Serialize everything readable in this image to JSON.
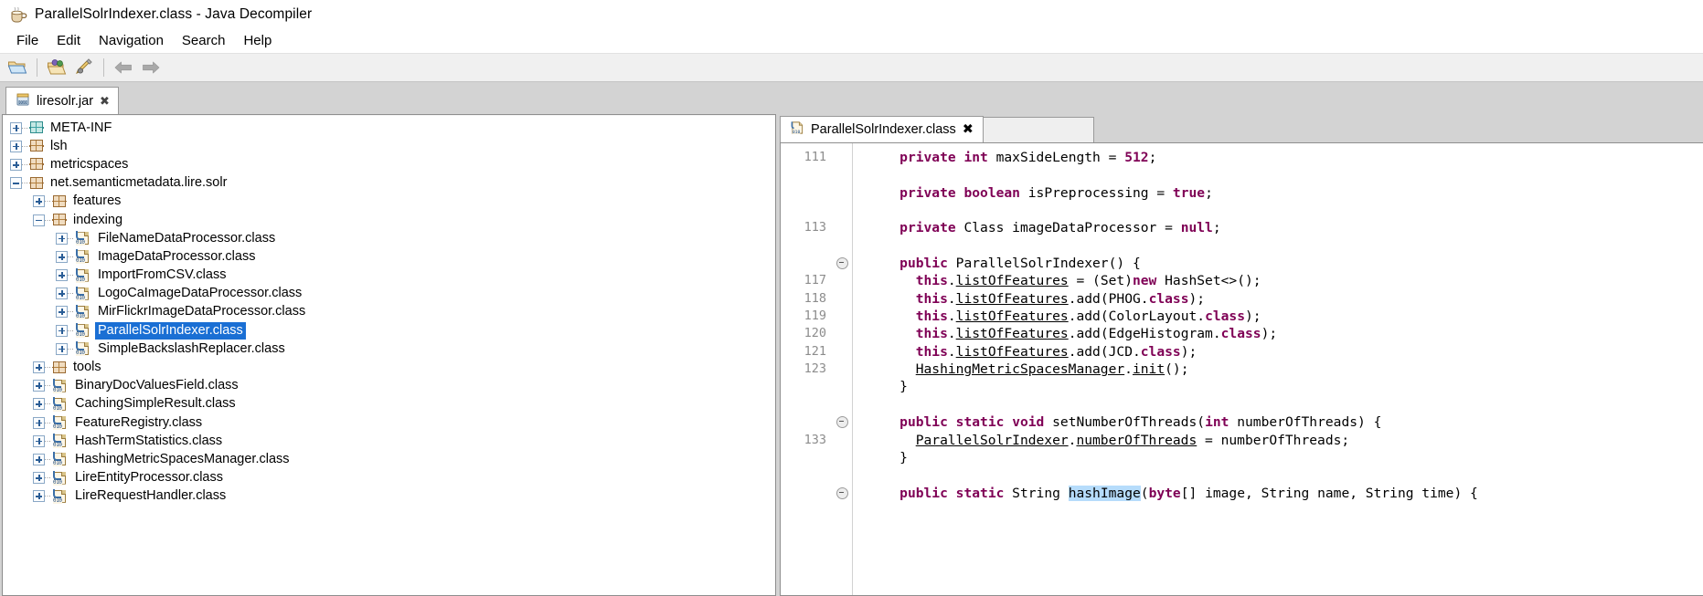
{
  "window": {
    "title": "ParallelSolrIndexer.class - Java Decompiler",
    "icon": "coffee-cup-icon"
  },
  "menubar": {
    "items": [
      "File",
      "Edit",
      "Navigation",
      "Search",
      "Help"
    ]
  },
  "toolbar": {
    "buttons": [
      {
        "name": "open-file-icon",
        "title": "Open File"
      },
      {
        "name": "open-type-icon",
        "title": "Open Type"
      },
      {
        "name": "search-pen-icon",
        "title": "Search"
      },
      {
        "name": "back-arrow-icon",
        "title": "Back"
      },
      {
        "name": "forward-arrow-icon",
        "title": "Forward"
      }
    ]
  },
  "jar_tabs": [
    {
      "label": "liresolr.jar",
      "close": "✖",
      "active": true
    }
  ],
  "tree": {
    "rows": [
      {
        "indent": 0,
        "expander": "plus",
        "icon": "package-teal",
        "label": "META-INF",
        "selected": false
      },
      {
        "indent": 0,
        "expander": "plus",
        "icon": "package",
        "label": "lsh",
        "selected": false
      },
      {
        "indent": 0,
        "expander": "plus",
        "icon": "package",
        "label": "metricspaces",
        "selected": false
      },
      {
        "indent": 0,
        "expander": "minus",
        "icon": "package",
        "label": "net.semanticmetadata.lire.solr",
        "selected": false
      },
      {
        "indent": 1,
        "expander": "plus",
        "icon": "package",
        "label": "features",
        "selected": false
      },
      {
        "indent": 1,
        "expander": "minus",
        "icon": "package",
        "label": "indexing",
        "selected": false
      },
      {
        "indent": 2,
        "expander": "plus",
        "icon": "class",
        "label": "FileNameDataProcessor.class",
        "selected": false
      },
      {
        "indent": 2,
        "expander": "plus",
        "icon": "class",
        "label": "ImageDataProcessor.class",
        "selected": false
      },
      {
        "indent": 2,
        "expander": "plus",
        "icon": "class",
        "label": "ImportFromCSV.class",
        "selected": false
      },
      {
        "indent": 2,
        "expander": "plus",
        "icon": "class",
        "label": "LogoCaImageDataProcessor.class",
        "selected": false
      },
      {
        "indent": 2,
        "expander": "plus",
        "icon": "class",
        "label": "MirFlickrImageDataProcessor.class",
        "selected": false
      },
      {
        "indent": 2,
        "expander": "plus",
        "icon": "class",
        "label": "ParallelSolrIndexer.class",
        "selected": true
      },
      {
        "indent": 2,
        "expander": "plus",
        "icon": "class",
        "label": "SimpleBackslashReplacer.class",
        "selected": false
      },
      {
        "indent": 1,
        "expander": "plus",
        "icon": "package",
        "label": "tools",
        "selected": false
      },
      {
        "indent": 1,
        "expander": "plus",
        "icon": "class",
        "label": "BinaryDocValuesField.class",
        "selected": false
      },
      {
        "indent": 1,
        "expander": "plus",
        "icon": "class",
        "label": "CachingSimpleResult.class",
        "selected": false
      },
      {
        "indent": 1,
        "expander": "plus",
        "icon": "class",
        "label": "FeatureRegistry.class",
        "selected": false
      },
      {
        "indent": 1,
        "expander": "plus",
        "icon": "class",
        "label": "HashTermStatistics.class",
        "selected": false
      },
      {
        "indent": 1,
        "expander": "plus",
        "icon": "class",
        "label": "HashingMetricSpacesManager.class",
        "selected": false
      },
      {
        "indent": 1,
        "expander": "plus",
        "icon": "class",
        "label": "LireEntityProcessor.class",
        "selected": false
      },
      {
        "indent": 1,
        "expander": "plus",
        "icon": "class",
        "label": "LireRequestHandler.class",
        "selected": false
      }
    ],
    "selection_color": "#1a6fd4"
  },
  "editor": {
    "tabs": [
      {
        "label": "ParallelSolrIndexer.class",
        "close": "✖",
        "active": true
      }
    ],
    "colors": {
      "keyword": "#7f0055",
      "highlight": "#b6dcfb",
      "gutter": "#8c8c8c"
    },
    "lines": [
      {
        "num": "111",
        "fold": false,
        "tokens": [
          {
            "t": "    ",
            "c": "plain"
          },
          {
            "t": "private",
            "c": "kw"
          },
          {
            "t": " ",
            "c": "plain"
          },
          {
            "t": "int",
            "c": "kw"
          },
          {
            "t": " maxSideLength = ",
            "c": "plain"
          },
          {
            "t": "512",
            "c": "kw"
          },
          {
            "t": ";",
            "c": "plain"
          }
        ]
      },
      {
        "num": "",
        "fold": false,
        "tokens": [
          {
            "t": "",
            "c": "plain"
          }
        ]
      },
      {
        "num": "",
        "fold": false,
        "tokens": [
          {
            "t": "    ",
            "c": "plain"
          },
          {
            "t": "private",
            "c": "kw"
          },
          {
            "t": " ",
            "c": "plain"
          },
          {
            "t": "boolean",
            "c": "kw"
          },
          {
            "t": " isPreprocessing = ",
            "c": "plain"
          },
          {
            "t": "true",
            "c": "kw"
          },
          {
            "t": ";",
            "c": "plain"
          }
        ]
      },
      {
        "num": "",
        "fold": false,
        "tokens": [
          {
            "t": "",
            "c": "plain"
          }
        ]
      },
      {
        "num": "113",
        "fold": false,
        "tokens": [
          {
            "t": "    ",
            "c": "plain"
          },
          {
            "t": "private",
            "c": "kw"
          },
          {
            "t": " Class imageDataProcessor = ",
            "c": "plain"
          },
          {
            "t": "null",
            "c": "kw"
          },
          {
            "t": ";",
            "c": "plain"
          }
        ]
      },
      {
        "num": "",
        "fold": false,
        "tokens": [
          {
            "t": "",
            "c": "plain"
          }
        ]
      },
      {
        "num": "",
        "fold": true,
        "tokens": [
          {
            "t": "    ",
            "c": "plain"
          },
          {
            "t": "public",
            "c": "kw"
          },
          {
            "t": " ParallelSolrIndexer() {",
            "c": "plain"
          }
        ]
      },
      {
        "num": "117",
        "fold": false,
        "tokens": [
          {
            "t": "      ",
            "c": "plain"
          },
          {
            "t": "this",
            "c": "kw"
          },
          {
            "t": ".",
            "c": "plain"
          },
          {
            "t": "listOfFeatures",
            "c": "fld"
          },
          {
            "t": " = (Set)",
            "c": "plain"
          },
          {
            "t": "new",
            "c": "kw"
          },
          {
            "t": " HashSet<>();",
            "c": "plain"
          }
        ]
      },
      {
        "num": "118",
        "fold": false,
        "tokens": [
          {
            "t": "      ",
            "c": "plain"
          },
          {
            "t": "this",
            "c": "kw"
          },
          {
            "t": ".",
            "c": "plain"
          },
          {
            "t": "listOfFeatures",
            "c": "fld"
          },
          {
            "t": ".add(PHOG.",
            "c": "plain"
          },
          {
            "t": "class",
            "c": "kw"
          },
          {
            "t": ");",
            "c": "plain"
          }
        ]
      },
      {
        "num": "119",
        "fold": false,
        "tokens": [
          {
            "t": "      ",
            "c": "plain"
          },
          {
            "t": "this",
            "c": "kw"
          },
          {
            "t": ".",
            "c": "plain"
          },
          {
            "t": "listOfFeatures",
            "c": "fld"
          },
          {
            "t": ".add(ColorLayout.",
            "c": "plain"
          },
          {
            "t": "class",
            "c": "kw"
          },
          {
            "t": ");",
            "c": "plain"
          }
        ]
      },
      {
        "num": "120",
        "fold": false,
        "tokens": [
          {
            "t": "      ",
            "c": "plain"
          },
          {
            "t": "this",
            "c": "kw"
          },
          {
            "t": ".",
            "c": "plain"
          },
          {
            "t": "listOfFeatures",
            "c": "fld"
          },
          {
            "t": ".add(EdgeHistogram.",
            "c": "plain"
          },
          {
            "t": "class",
            "c": "kw"
          },
          {
            "t": ");",
            "c": "plain"
          }
        ]
      },
      {
        "num": "121",
        "fold": false,
        "tokens": [
          {
            "t": "      ",
            "c": "plain"
          },
          {
            "t": "this",
            "c": "kw"
          },
          {
            "t": ".",
            "c": "plain"
          },
          {
            "t": "listOfFeatures",
            "c": "fld"
          },
          {
            "t": ".add(JCD.",
            "c": "plain"
          },
          {
            "t": "class",
            "c": "kw"
          },
          {
            "t": ");",
            "c": "plain"
          }
        ]
      },
      {
        "num": "123",
        "fold": false,
        "tokens": [
          {
            "t": "      ",
            "c": "plain"
          },
          {
            "t": "HashingMetricSpacesManager",
            "c": "fld"
          },
          {
            "t": ".",
            "c": "plain"
          },
          {
            "t": "init",
            "c": "fld"
          },
          {
            "t": "();",
            "c": "plain"
          }
        ]
      },
      {
        "num": "",
        "fold": false,
        "tokens": [
          {
            "t": "    }",
            "c": "plain"
          }
        ]
      },
      {
        "num": "",
        "fold": false,
        "tokens": [
          {
            "t": "",
            "c": "plain"
          }
        ]
      },
      {
        "num": "",
        "fold": true,
        "tokens": [
          {
            "t": "    ",
            "c": "plain"
          },
          {
            "t": "public",
            "c": "kw"
          },
          {
            "t": " ",
            "c": "plain"
          },
          {
            "t": "static",
            "c": "kw"
          },
          {
            "t": " ",
            "c": "plain"
          },
          {
            "t": "void",
            "c": "kw"
          },
          {
            "t": " setNumberOfThreads(",
            "c": "plain"
          },
          {
            "t": "int",
            "c": "kw"
          },
          {
            "t": " numberOfThreads) {",
            "c": "plain"
          }
        ]
      },
      {
        "num": "133",
        "fold": false,
        "tokens": [
          {
            "t": "      ",
            "c": "plain"
          },
          {
            "t": "ParallelSolrIndexer",
            "c": "fld"
          },
          {
            "t": ".",
            "c": "plain"
          },
          {
            "t": "numberOfThreads",
            "c": "fld"
          },
          {
            "t": " = numberOfThreads;",
            "c": "plain"
          }
        ]
      },
      {
        "num": "",
        "fold": false,
        "tokens": [
          {
            "t": "    }",
            "c": "plain"
          }
        ]
      },
      {
        "num": "",
        "fold": false,
        "tokens": [
          {
            "t": "",
            "c": "plain"
          }
        ]
      },
      {
        "num": "",
        "fold": true,
        "tokens": [
          {
            "t": "    ",
            "c": "plain"
          },
          {
            "t": "public",
            "c": "kw"
          },
          {
            "t": " ",
            "c": "plain"
          },
          {
            "t": "static",
            "c": "kw"
          },
          {
            "t": " String ",
            "c": "plain"
          },
          {
            "t": "hashImage",
            "c": "hl"
          },
          {
            "t": "(",
            "c": "plain"
          },
          {
            "t": "byte",
            "c": "kw"
          },
          {
            "t": "[] image, String name, String time) {",
            "c": "plain"
          }
        ]
      }
    ]
  }
}
